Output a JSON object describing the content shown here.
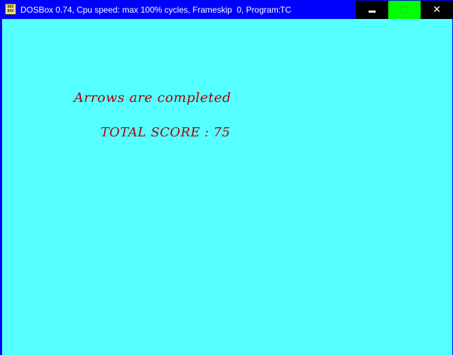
{
  "window": {
    "title": "DOSBox 0.74, Cpu speed: max 100% cycles, Frameskip  0, Program:",
    "program": "TC",
    "icon": "dosbox-icon",
    "icon_text": "DOS BOX"
  },
  "controls": {
    "minimize_icon": "minimize-icon",
    "maximize_icon": "maximize-icon",
    "close_icon": "close-icon",
    "close_glyph": "✕"
  },
  "screen": {
    "background": "#55ffff",
    "text_color": "#aa0000",
    "line1": "Arrows are completed",
    "line2": "TOTAL SCORE : 75"
  }
}
